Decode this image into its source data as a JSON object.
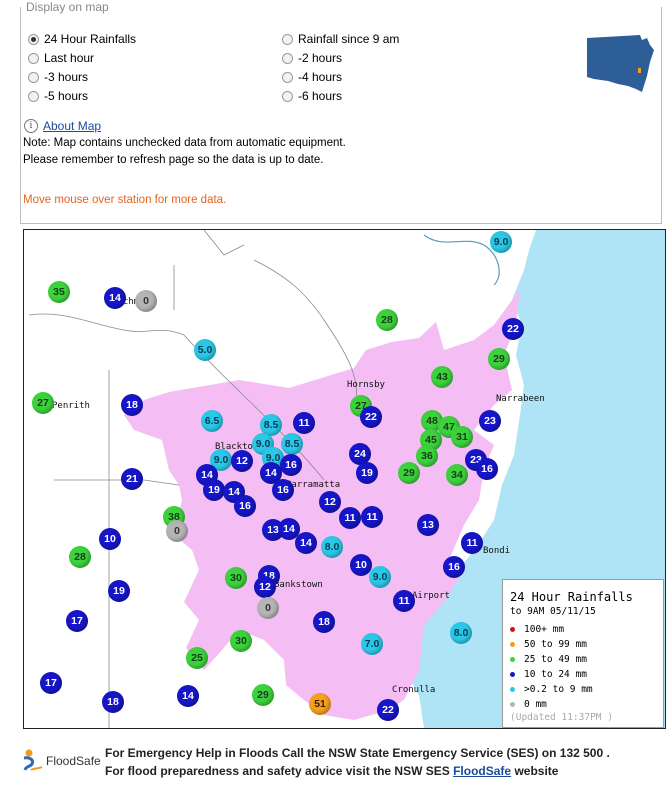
{
  "panel": {
    "title": "Display on map",
    "options": [
      {
        "label": "24 Hour Rainfalls",
        "checked": true
      },
      {
        "label": "Last hour",
        "checked": false
      },
      {
        "label": "-3 hours",
        "checked": false
      },
      {
        "label": "-5 hours",
        "checked": false
      },
      {
        "label": "Rainfall since 9 am",
        "checked": false
      },
      {
        "label": "-2 hours",
        "checked": false
      },
      {
        "label": "-4 hours",
        "checked": false
      },
      {
        "label": "-6 hours",
        "checked": false
      }
    ],
    "about_link": "About Map",
    "note1": "Note: Map contains unchecked data from automatic equipment.",
    "note2": "Please remember to refresh page so the data is up to date.",
    "hover_note": "Move mouse over station for more data."
  },
  "map": {
    "towns": [
      "Richmond",
      "Penrith",
      "Hornsby",
      "Narrabeen",
      "Blacktown",
      "Parramatta",
      "Bondi",
      "Bankstown",
      "Airport",
      "Cronulla"
    ],
    "stations": [
      {
        "value": "35",
        "category": "25 to 49"
      },
      {
        "value": "14",
        "category": "10 to 24"
      },
      {
        "value": "0",
        "category": "0"
      },
      {
        "value": "9.0",
        "category": ">0.2 to 9"
      },
      {
        "value": "28",
        "category": "25 to 49"
      },
      {
        "value": "22",
        "category": "10 to 24"
      },
      {
        "value": "5.0",
        "category": ">0.2 to 9"
      },
      {
        "value": "29",
        "category": "25 to 49"
      },
      {
        "value": "43",
        "category": "25 to 49"
      },
      {
        "value": "27",
        "category": "25 to 49"
      },
      {
        "value": "18",
        "category": "10 to 24"
      },
      {
        "value": "27",
        "category": "25 to 49"
      },
      {
        "value": "6.5",
        "category": ">0.2 to 9"
      },
      {
        "value": "8.5",
        "category": ">0.2 to 9"
      },
      {
        "value": "11",
        "category": "10 to 24"
      },
      {
        "value": "22",
        "category": "10 to 24"
      },
      {
        "value": "48",
        "category": "25 to 49"
      },
      {
        "value": "47",
        "category": "25 to 49"
      },
      {
        "value": "23",
        "category": "10 to 24"
      },
      {
        "value": "9.0",
        "category": ">0.2 to 9"
      },
      {
        "value": "8.5",
        "category": ">0.2 to 9"
      },
      {
        "value": "45",
        "category": "25 to 49"
      },
      {
        "value": "31",
        "category": "25 to 49"
      },
      {
        "value": "9.0",
        "category": ">0.2 to 9"
      },
      {
        "value": "12",
        "category": "10 to 24"
      },
      {
        "value": "9.0",
        "category": ">0.2 to 9"
      },
      {
        "value": "16",
        "category": "10 to 24"
      },
      {
        "value": "24",
        "category": "10 to 24"
      },
      {
        "value": "36",
        "category": "25 to 49"
      },
      {
        "value": "23",
        "category": "10 to 24"
      },
      {
        "value": "16",
        "category": "10 to 24"
      },
      {
        "value": "21",
        "category": "10 to 24"
      },
      {
        "value": "14",
        "category": "10 to 24"
      },
      {
        "value": "14",
        "category": "10 to 24"
      },
      {
        "value": "19",
        "category": "10 to 24"
      },
      {
        "value": "29",
        "category": "25 to 49"
      },
      {
        "value": "34",
        "category": "25 to 49"
      },
      {
        "value": "19",
        "category": "10 to 24"
      },
      {
        "value": "14",
        "category": "10 to 24"
      },
      {
        "value": "16",
        "category": "10 to 24"
      },
      {
        "value": "16",
        "category": "10 to 24"
      },
      {
        "value": "12",
        "category": "10 to 24"
      },
      {
        "value": "38",
        "category": "25 to 49"
      },
      {
        "value": "0",
        "category": "0"
      },
      {
        "value": "11",
        "category": "10 to 24"
      },
      {
        "value": "11",
        "category": "10 to 24"
      },
      {
        "value": "13",
        "category": "10 to 24"
      },
      {
        "value": "13",
        "category": "10 to 24"
      },
      {
        "value": "14",
        "category": "10 to 24"
      },
      {
        "value": "10",
        "category": "10 to 24"
      },
      {
        "value": "14",
        "category": "10 to 24"
      },
      {
        "value": "8.0",
        "category": ">0.2 to 9"
      },
      {
        "value": "11",
        "category": "10 to 24"
      },
      {
        "value": "28",
        "category": "25 to 49"
      },
      {
        "value": "10",
        "category": "10 to 24"
      },
      {
        "value": "9.0",
        "category": ">0.2 to 9"
      },
      {
        "value": "16",
        "category": "10 to 24"
      },
      {
        "value": "19",
        "category": "10 to 24"
      },
      {
        "value": "30",
        "category": "25 to 49"
      },
      {
        "value": "18",
        "category": "10 to 24"
      },
      {
        "value": "12",
        "category": "10 to 24"
      },
      {
        "value": "0",
        "category": "0"
      },
      {
        "value": "11",
        "category": "10 to 24"
      },
      {
        "value": "17",
        "category": "10 to 24"
      },
      {
        "value": "18",
        "category": "10 to 24"
      },
      {
        "value": "30",
        "category": "25 to 49"
      },
      {
        "value": "7.0",
        "category": ">0.2 to 9"
      },
      {
        "value": "8.0",
        "category": ">0.2 to 9"
      },
      {
        "value": "25",
        "category": "25 to 49"
      },
      {
        "value": "17",
        "category": "10 to 24"
      },
      {
        "value": "14",
        "category": "10 to 24"
      },
      {
        "value": "29",
        "category": "25 to 49"
      },
      {
        "value": "51",
        "category": "50 to 99"
      },
      {
        "value": "18",
        "category": "10 to 24"
      },
      {
        "value": "22",
        "category": "10 to 24"
      }
    ]
  },
  "legend": {
    "title": "24 Hour Rainfalls",
    "subtitle": "to 9AM 05/11/15",
    "items": [
      {
        "label": "100+ mm",
        "color": "#d21414"
      },
      {
        "label": "50  to 99 mm",
        "color": "#f5a01e"
      },
      {
        "label": "25  to 49 mm",
        "color": "#3cd23c"
      },
      {
        "label": "10  to 24 mm",
        "color": "#1616c8"
      },
      {
        "label": ">0.2 to 9 mm",
        "color": "#2ac8e6"
      },
      {
        "label": "0  mm",
        "color": "#b4b4b4"
      }
    ],
    "updated": "(Updated 11:37PM  )"
  },
  "footer": {
    "logo_text": "FloodSafe",
    "line1": "For Emergency Help in Floods Call the NSW State Emergency Service (SES) on 132 500 .",
    "line2_pre": "For flood preparedness and safety advice visit the NSW SES ",
    "line2_link": "FloodSafe",
    "line2_post": " website"
  },
  "colors": {
    "urban": "#f4bdf4",
    "sea": "#aee4f5",
    "warning": "#e66420"
  }
}
